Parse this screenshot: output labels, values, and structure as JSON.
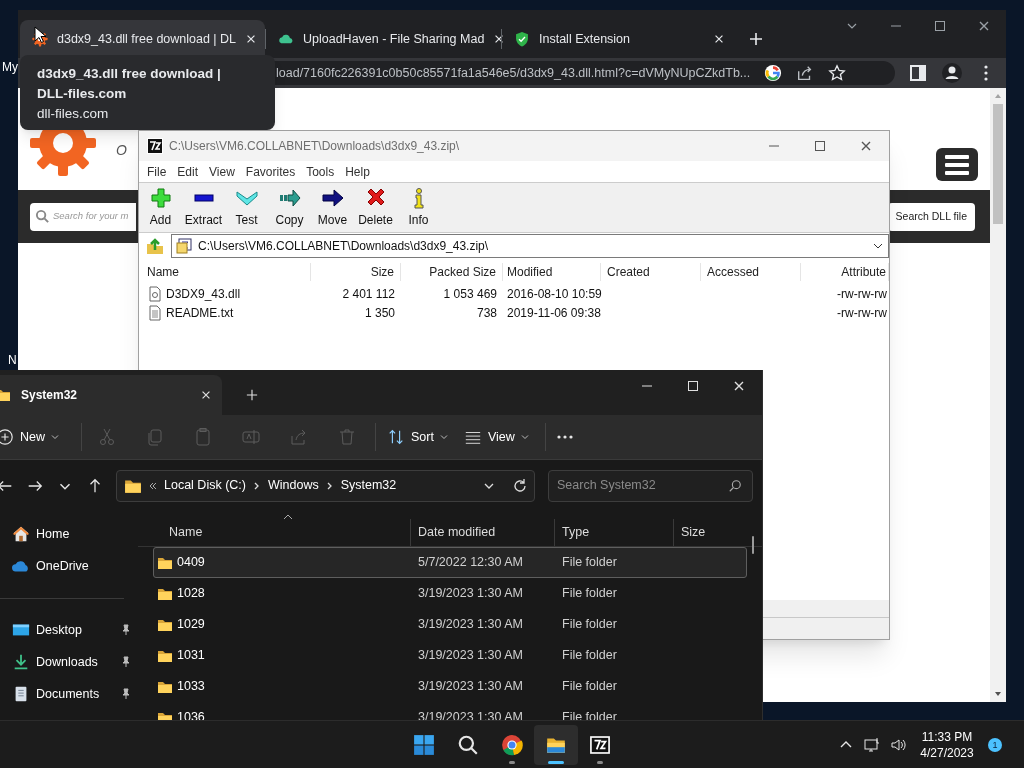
{
  "desktop": {
    "icon_labels": [
      "My",
      "N"
    ]
  },
  "browser": {
    "tabs": [
      {
        "kind": "gear",
        "title": "d3dx9_43.dll free download | DL",
        "selected": true
      },
      {
        "kind": "cloud",
        "title": "UploadHaven - File Sharing Mad",
        "selected": false
      },
      {
        "kind": "shield",
        "title": "Install Extension",
        "selected": false
      }
    ],
    "url": "load/7160fc226391c0b50c85571fa1a546e5/d3dx9_43.dll.html?c=dVMyNUpCZkdTb...",
    "tooltip": {
      "title": "d3dx9_43.dll free download | DLL-files.com",
      "domain": "dll-files.com"
    },
    "page": {
      "tagline": "O",
      "search_placeholder": "Search for your m",
      "search_button": "Search DLL file"
    }
  },
  "archive_window": {
    "title": "C:\\Users\\VM6.COLLABNET\\Downloads\\d3dx9_43.zip\\",
    "menu": [
      "File",
      "Edit",
      "View",
      "Favorites",
      "Tools",
      "Help"
    ],
    "toolbar": [
      {
        "kind": "add",
        "label": "Add"
      },
      {
        "kind": "extract",
        "label": "Extract"
      },
      {
        "kind": "test",
        "label": "Test"
      },
      {
        "kind": "copy",
        "label": "Copy"
      },
      {
        "kind": "move",
        "label": "Move"
      },
      {
        "kind": "delete",
        "label": "Delete"
      },
      {
        "kind": "info",
        "label": "Info"
      }
    ],
    "path": "C:\\Users\\VM6.COLLABNET\\Downloads\\d3dx9_43.zip\\",
    "columns": [
      "Name",
      "Size",
      "Packed Size",
      "Modified",
      "Created",
      "Accessed",
      "Attribute"
    ],
    "rows": [
      {
        "kind": "dll",
        "name": "D3DX9_43.dll",
        "size": "2 401 112",
        "packed_size": "1 053 469",
        "modified": "2016-08-10 10:59",
        "attributes": "-rw-rw-rw"
      },
      {
        "kind": "text",
        "name": "README.txt",
        "size": "1 350",
        "packed_size": "738",
        "modified": "2019-11-06 09:38",
        "attributes": "-rw-rw-rw"
      }
    ]
  },
  "explorer": {
    "tab": "System32",
    "toolbar": [
      {
        "kind": "new",
        "label": "New",
        "disabled": false
      },
      {
        "kind": "cut",
        "disabled": true
      },
      {
        "kind": "copy",
        "disabled": true
      },
      {
        "kind": "paste",
        "disabled": true
      },
      {
        "kind": "rename",
        "disabled": true
      },
      {
        "kind": "share",
        "disabled": true
      },
      {
        "kind": "delete",
        "disabled": true
      },
      {
        "kind": "sort",
        "label": "Sort",
        "disabled": false
      },
      {
        "kind": "view",
        "label": "View",
        "disabled": false
      },
      {
        "kind": "more",
        "disabled": false
      }
    ],
    "breadcrumb": [
      "Local Disk (C:)",
      "Windows",
      "System32"
    ],
    "search_placeholder": "Search System32",
    "sidebar": [
      {
        "kind": "home",
        "label": "Home",
        "pinned": false
      },
      {
        "kind": "cloud",
        "label": "OneDrive",
        "pinned": false
      },
      {
        "kind": "desktop",
        "label": "Desktop",
        "pinned": true
      },
      {
        "kind": "downloads",
        "label": "Downloads",
        "pinned": true
      },
      {
        "kind": "documents",
        "label": "Documents",
        "pinned": true
      }
    ],
    "columns": [
      "Name",
      "Date modified",
      "Type",
      "Size"
    ],
    "rows": [
      {
        "name": "0409",
        "date_modified": "5/7/2022 12:30 AM",
        "type": "File folder",
        "selected": true
      },
      {
        "name": "1028",
        "date_modified": "3/19/2023 1:30 AM",
        "type": "File folder",
        "selected": false
      },
      {
        "name": "1029",
        "date_modified": "3/19/2023 1:30 AM",
        "type": "File folder",
        "selected": false
      },
      {
        "name": "1031",
        "date_modified": "3/19/2023 1:30 AM",
        "type": "File folder",
        "selected": false
      },
      {
        "name": "1033",
        "date_modified": "3/19/2023 1:30 AM",
        "type": "File folder",
        "selected": false
      },
      {
        "name": "1036",
        "date_modified": "3/19/2023 1:30 AM",
        "type": "File folder",
        "selected": false
      }
    ]
  },
  "taskbar": {
    "apps": [
      {
        "kind": "start",
        "active": false
      },
      {
        "kind": "search",
        "active": false
      },
      {
        "kind": "browser",
        "active": false
      },
      {
        "kind": "explorer",
        "active": true
      },
      {
        "kind": "archiver",
        "active": false
      }
    ],
    "time": "11:33 PM",
    "date": "4/27/2023",
    "notification_count": "1"
  }
}
